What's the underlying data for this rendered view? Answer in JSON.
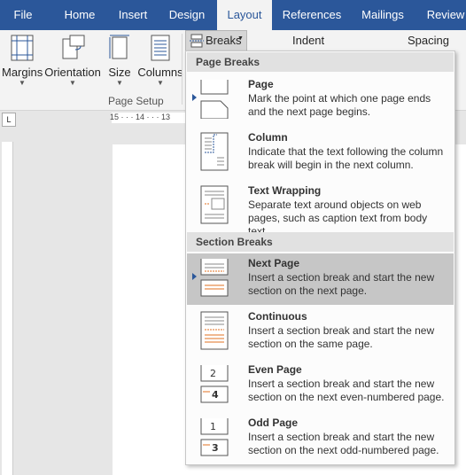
{
  "tabs": [
    {
      "label": "File"
    },
    {
      "label": "Home"
    },
    {
      "label": "Insert"
    },
    {
      "label": "Design"
    },
    {
      "label": "Layout"
    },
    {
      "label": "References"
    },
    {
      "label": "Mailings"
    },
    {
      "label": "Review"
    }
  ],
  "ribbon": {
    "margins": "Margins",
    "orientation": "Orientation",
    "size": "Size",
    "columns": "Columns",
    "breaks": "Breaks",
    "group_label": "Page Setup",
    "indent": "Indent",
    "spacing": "Spacing",
    "ruler_text": "15 · · · 14 · · · 13"
  },
  "menu": {
    "page_breaks_header": "Page Breaks",
    "section_breaks_header": "Section Breaks",
    "items": [
      {
        "title": "Page",
        "desc": "Mark the point at which one page ends and the next page begins."
      },
      {
        "title": "Column",
        "desc": "Indicate that the text following the column break will begin in the next column."
      },
      {
        "title": "Text Wrapping",
        "desc": "Separate text around objects on web pages, such as caption text from body text."
      },
      {
        "title": "Next Page",
        "desc": "Insert a section break and start the new section on the next page."
      },
      {
        "title": "Continuous",
        "desc": "Insert a section break and start the new section on the same page."
      },
      {
        "title": "Even Page",
        "desc": "Insert a section break and start the new section on the next even-numbered page."
      },
      {
        "title": "Odd Page",
        "desc": "Insert a section break and start the new section on the next odd-numbered page."
      }
    ],
    "even_digits": [
      "2",
      "4"
    ],
    "odd_digits": [
      "1",
      "3"
    ]
  },
  "colors": {
    "accent": "#2b579a",
    "selected": "#c6c6c6"
  }
}
